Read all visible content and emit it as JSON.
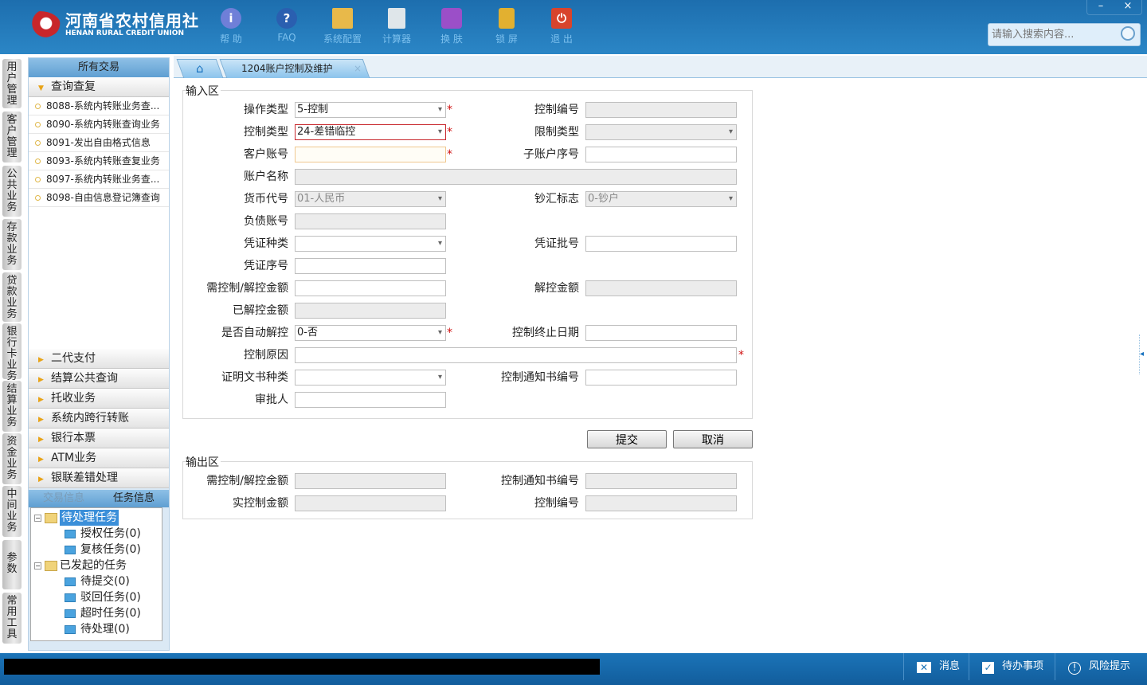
{
  "header": {
    "logo_cn": "河南省农村信用社",
    "logo_en": "HENAN RURAL CREDIT UNION",
    "tools": [
      {
        "label": "帮 助",
        "icon": "info-icon"
      },
      {
        "label": "FAQ",
        "icon": "question-icon"
      },
      {
        "label": "系统配置",
        "icon": "toolbox-icon"
      },
      {
        "label": "计算器",
        "icon": "calculator-icon"
      },
      {
        "label": "换 肤",
        "icon": "shirt-icon"
      },
      {
        "label": "锁 屏",
        "icon": "lock-icon"
      },
      {
        "label": "退 出",
        "icon": "power-icon"
      }
    ],
    "minimize": "–",
    "close": "×",
    "search_placeholder": "请输入搜索内容..."
  },
  "vtabs": [
    "用户管理",
    "客户管理",
    "公共业务",
    "存款业务",
    "贷款业务",
    "银行卡业务",
    "结算业务",
    "资金业务",
    "中间业务",
    "参数",
    "常用工具"
  ],
  "sidebar": {
    "title": "所有交易",
    "open_group": "查询查复",
    "items": [
      "8088-系统内转账业务查...",
      "8090-系统内转账查询业务",
      "8091-发出自由格式信息",
      "8093-系统内转账查复业务",
      "8097-系统内转账业务查...",
      "8098-自由信息登记簿查询"
    ],
    "groups": [
      "二代支付",
      "结算公共查询",
      "托收业务",
      "系统内跨行转账",
      "银行本票",
      "ATM业务",
      "银联差错处理"
    ],
    "tabs": [
      "交易信息",
      "任务信息"
    ],
    "tree": [
      {
        "label": "待处理任务",
        "children": [
          "授权任务(0)",
          "复核任务(0)"
        ]
      },
      {
        "label": "已发起的任务",
        "children": [
          "待提交(0)",
          "驳回任务(0)",
          "超时任务(0)",
          "待处理(0)"
        ]
      }
    ]
  },
  "tabs": {
    "active": "1204账户控制及维护",
    "close": "×"
  },
  "input_area": {
    "legend": "输入区",
    "op_type": {
      "label": "操作类型",
      "value": "5-控制"
    },
    "ctrl_no": {
      "label": "控制编号",
      "value": ""
    },
    "ctrl_type": {
      "label": "控制类型",
      "value": "24-差错临控"
    },
    "limit_type": {
      "label": "限制类型",
      "value": ""
    },
    "cust_acct": {
      "label": "客户账号",
      "value": ""
    },
    "sub_seq": {
      "label": "子账户序号",
      "value": ""
    },
    "acct_name": {
      "label": "账户名称",
      "value": ""
    },
    "currency": {
      "label": "货币代号",
      "value": "01-人民币"
    },
    "cash_flag": {
      "label": "钞汇标志",
      "value": "0-钞户"
    },
    "liab_acct": {
      "label": "负债账号",
      "value": ""
    },
    "voucher_type": {
      "label": "凭证种类",
      "value": ""
    },
    "voucher_batch": {
      "label": "凭证批号",
      "value": ""
    },
    "voucher_seq": {
      "label": "凭证序号",
      "value": ""
    },
    "need_amt": {
      "label": "需控制/解控金额",
      "value": ""
    },
    "release_amt": {
      "label": "解控金额",
      "value": ""
    },
    "released_amt": {
      "label": "已解控金额",
      "value": ""
    },
    "auto_release": {
      "label": "是否自动解控",
      "value": "0-否"
    },
    "end_date": {
      "label": "控制终止日期",
      "value": ""
    },
    "reason": {
      "label": "控制原因",
      "value": ""
    },
    "doc_type": {
      "label": "证明文书种类",
      "value": ""
    },
    "notice_no": {
      "label": "控制通知书编号",
      "value": ""
    },
    "approver": {
      "label": "审批人",
      "value": ""
    },
    "required_mark": "*"
  },
  "buttons": {
    "submit": "提交",
    "cancel": "取消"
  },
  "output_area": {
    "legend": "输出区",
    "need_amt": {
      "label": "需控制/解控金额",
      "value": ""
    },
    "notice_no": {
      "label": "控制通知书编号",
      "value": ""
    },
    "actual_amt": {
      "label": "实控制金额",
      "value": ""
    },
    "ctrl_no": {
      "label": "控制编号",
      "value": ""
    }
  },
  "statusbar": {
    "message": "消息",
    "todo": "待办事项",
    "risk": "风险提示"
  }
}
